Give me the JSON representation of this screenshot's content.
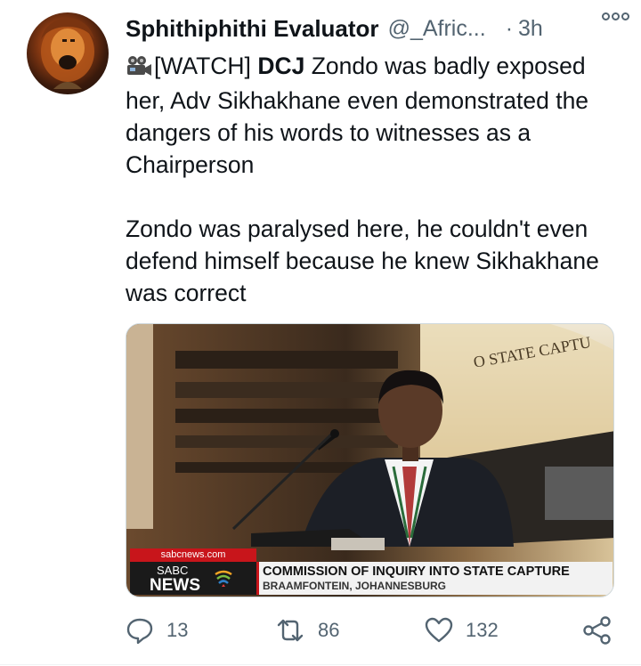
{
  "author": {
    "display_name": "Sphithiphithi Evaluator",
    "handle": "@_Afric...",
    "separator": "·",
    "time": "3h"
  },
  "tweet": {
    "camera_icon": "movie-camera-icon",
    "watch_tag": "[WATCH]",
    "bold_word": "DCJ",
    "line1_rest": "Zondo was badly exposed her, Adv Sikhakhane even demonstrated the dangers of his words to witnesses as a Chairperson",
    "paragraph2": "Zondo was paralysed here, he couldn't even defend himself because he knew Sikhakhane was correct"
  },
  "media": {
    "backdrop_text": "O STATE CAPTU",
    "sabc_url": "sabcnews.com",
    "sabc_brand_top": "SABC",
    "sabc_brand_bottom": "NEWS",
    "ticker_title": "COMMISSION OF INQUIRY INTO STATE CAPTURE",
    "ticker_location": "BRAAMFONTEIN, JOHANNESBURG"
  },
  "actions": {
    "reply_count": "13",
    "retweet_count": "86",
    "like_count": "132"
  },
  "colors": {
    "text_primary": "#0f1419",
    "text_secondary": "#536471",
    "sabc_red": "#c8151b"
  }
}
